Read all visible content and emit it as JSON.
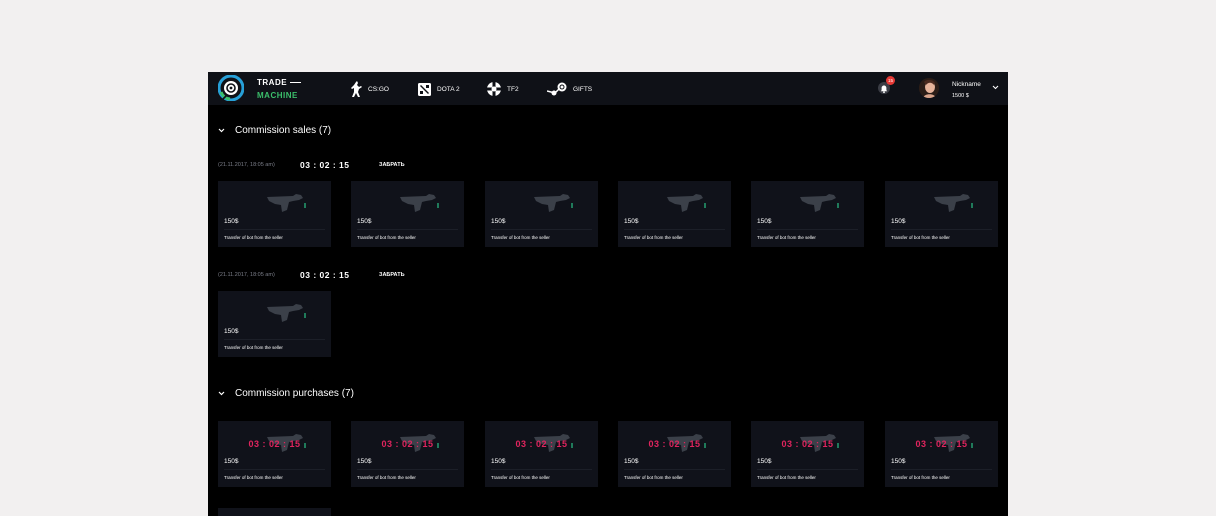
{
  "brand": {
    "line1": "TRADE",
    "line2": "MACHINE"
  },
  "nav": [
    {
      "label": "CS:GO",
      "icon": "counter-strike-icon"
    },
    {
      "label": "DOTA 2",
      "icon": "dota-icon"
    },
    {
      "label": "TF2",
      "icon": "tf2-icon"
    },
    {
      "label": "GIFTS",
      "icon": "steam-icon"
    }
  ],
  "user": {
    "notifications": "15",
    "nickname": "Nickname",
    "balance": "1500 $"
  },
  "sections": [
    {
      "title": "Commission sales (7)",
      "groups": [
        {
          "date": "(21.11.2017, 18:05 am)",
          "timer": "03 : 02 : 15",
          "action": "ЗАБРАТЬ",
          "items": [
            {
              "price": "150$",
              "status": "Transfer of bot from the seller"
            },
            {
              "price": "150$",
              "status": "Transfer of bot from the seller"
            },
            {
              "price": "150$",
              "status": "Transfer of bot from the seller"
            },
            {
              "price": "150$",
              "status": "Transfer of bot from the seller"
            },
            {
              "price": "150$",
              "status": "Transfer of bot from the seller"
            },
            {
              "price": "150$",
              "status": "Transfer of bot from the seller"
            }
          ]
        },
        {
          "date": "(21.11.2017, 18:05 am)",
          "timer": "03 : 02 : 15",
          "action": "ЗАБРАТЬ",
          "items": [
            {
              "price": "150$",
              "status": "Transfer of bot from the seller"
            }
          ]
        }
      ]
    },
    {
      "title": "Commission purchases (7)",
      "items": [
        {
          "timer": "03 : 02 : 15",
          "price": "150$",
          "status": "Transfer of bot from the seller"
        },
        {
          "timer": "03 : 02 : 15",
          "price": "150$",
          "status": "Transfer of bot from the seller"
        },
        {
          "timer": "03 : 02 : 15",
          "price": "150$",
          "status": "Transfer of bot from the seller"
        },
        {
          "timer": "03 : 02 : 15",
          "price": "150$",
          "status": "Transfer of bot from the seller"
        },
        {
          "timer": "03 : 02 : 15",
          "price": "150$",
          "status": "Transfer of bot from the seller"
        },
        {
          "timer": "03 : 02 : 15",
          "price": "150$",
          "status": "Transfer of bot from the seller"
        }
      ]
    }
  ],
  "colors": {
    "accent_green": "#3bbf6b",
    "accent_blue": "#27a0d8",
    "timer_red": "#e0245e",
    "badge_red": "#e53935"
  }
}
